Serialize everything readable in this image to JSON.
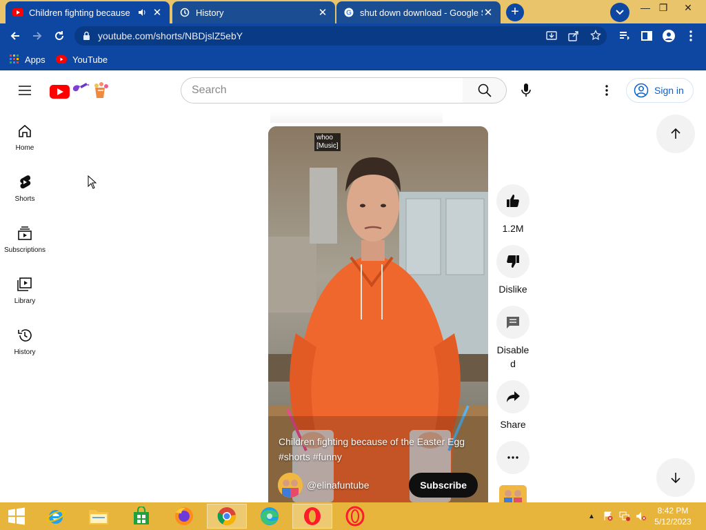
{
  "browser": {
    "tabs": [
      {
        "title": "Children fighting because of",
        "icon": "youtube-favicon",
        "active": true
      },
      {
        "title": "History",
        "icon": "history-icon",
        "active": false
      },
      {
        "title": "shut down download - Google S",
        "icon": "google-favicon",
        "active": false
      }
    ],
    "address": "youtube.com/shorts/NBDjslZ5ebY",
    "bookmarks": [
      {
        "label": "Apps",
        "icon": "apps-grid-icon"
      },
      {
        "label": "YouTube",
        "icon": "youtube-icon"
      }
    ],
    "colors": {
      "chrome": "#0e47a1",
      "tabstrip": "#e9c46a"
    }
  },
  "yt": {
    "search_placeholder": "Search",
    "sign_in": "Sign in",
    "guide": [
      {
        "label": "Home",
        "icon": "home-icon"
      },
      {
        "label": "Shorts",
        "icon": "shorts-icon"
      },
      {
        "label": "Subscriptions",
        "icon": "subscriptions-icon"
      },
      {
        "label": "Library",
        "icon": "library-icon"
      },
      {
        "label": "History",
        "icon": "history-icon"
      }
    ],
    "short": {
      "caption_tag_line1": "whoo",
      "caption_tag_line2": "[Music]",
      "title": "Children fighting because of the Easter Egg #shorts #funny",
      "channel": "@elinafuntube",
      "subscribe": "Subscribe"
    },
    "actions": {
      "likes": "1.2M",
      "dislike": "Dislike",
      "comments": "Disabled",
      "share": "Share"
    },
    "accent": "#ff0000",
    "link_color": "#065fd4"
  },
  "taskbar": {
    "apps": [
      "start-icon",
      "internet-explorer-icon",
      "file-explorer-icon",
      "store-icon",
      "firefox-icon",
      "chrome-icon",
      "edge-icon",
      "opera-icon",
      "opera-gx-icon"
    ],
    "time": "8:42 PM",
    "date": "5/12/2023"
  }
}
